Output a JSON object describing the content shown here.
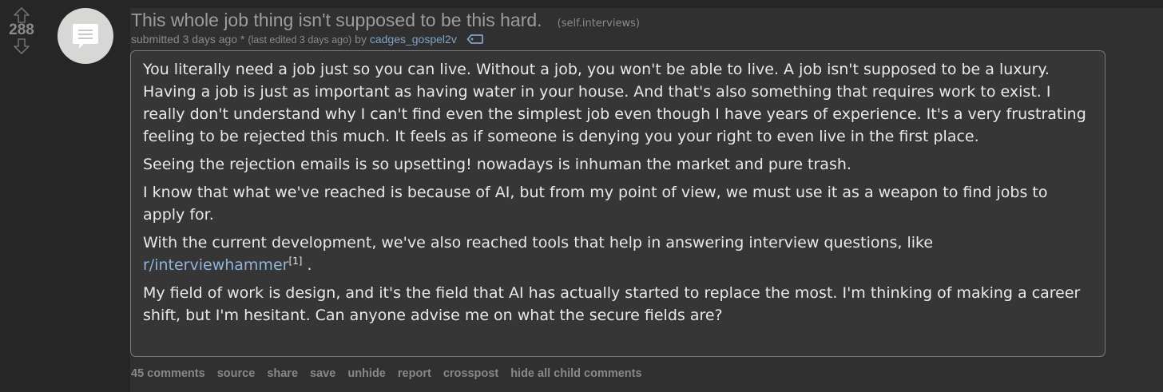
{
  "vote": {
    "score": "288",
    "upvote_icon": "arrow-up-icon",
    "downvote_icon": "arrow-down-icon"
  },
  "thumbnail": {
    "icon": "self-post-icon"
  },
  "post": {
    "title": "This whole job thing isn't supposed to be this hard.",
    "domain": "(self.interviews)",
    "tagline": {
      "submitted": "submitted 3 days ago * ",
      "edited": "(last edited 3 days ago)",
      "by": " by ",
      "author": "cadges_gospel2v",
      "author_icon": "tag-icon"
    },
    "body": {
      "p1": "You literally need a job just so you can live. Without a job, you won't be able to live. A job isn't supposed to be a luxury. Having a job is just as important as having water in your house. And that's also something that requires work to exist. I really don't understand why I can't find even the simplest job even though I have years of experience. It's a very frustrating feeling to be rejected this much. It feels as if someone is denying you your right to even live in the first place.",
      "p2": "Seeing the rejection emails is so upsetting! nowadays is inhuman the market and pure trash.",
      "p3": "I know that what we've reached is because of AI, but from my point of view, we must use it as a weapon to find jobs to apply for.",
      "p4_text": "With the current development, we've also reached tools that help in answering interview questions, like ",
      "p4_link": "r/interviewhammer",
      "p4_sup": "[1]",
      "p4_end": " .",
      "p5": "My field of work is design, and it's the field that AI has actually started to replace the most. I'm thinking of making a career shift, but I'm hesitant. Can anyone advise me on what the secure fields are?"
    },
    "buttons": {
      "comments": "45 comments",
      "source": "source",
      "share": "share",
      "save": "save",
      "unhide": "unhide",
      "report": "report",
      "crosspost": "crosspost",
      "hide_children": "hide all child comments"
    }
  },
  "colors": {
    "background": "#262626",
    "entry": "#303030",
    "body_box": "#363636",
    "link": "#8fb5dd",
    "author": "#7fa3c8"
  }
}
